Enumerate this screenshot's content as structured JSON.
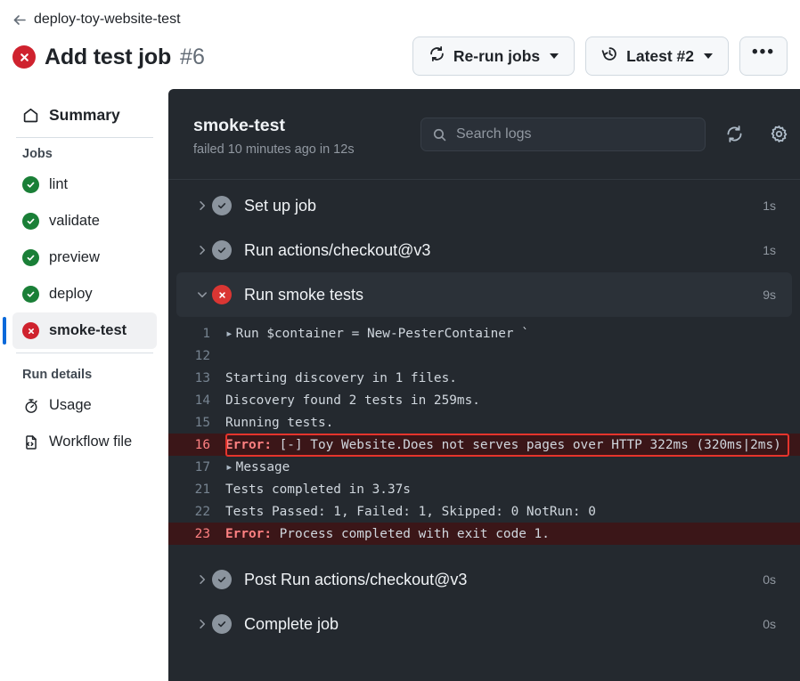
{
  "header": {
    "back_icon": "arrow-left-icon",
    "breadcrumb": "deploy-toy-website-test",
    "status_icon": "x-circle-icon",
    "title": "Add test job",
    "run_number": "#6",
    "actions": {
      "rerun_label": "Re-run jobs",
      "rerun_icon": "sync-icon",
      "latest_label": "Latest #2",
      "latest_icon": "history-icon",
      "overflow_label": "•••"
    }
  },
  "sidebar": {
    "summary": {
      "label": "Summary",
      "icon": "home-icon"
    },
    "jobs_heading": "Jobs",
    "jobs": [
      {
        "label": "lint",
        "status": "success",
        "icon": "check-circle-icon"
      },
      {
        "label": "validate",
        "status": "success",
        "icon": "check-circle-icon"
      },
      {
        "label": "preview",
        "status": "success",
        "icon": "check-circle-icon"
      },
      {
        "label": "deploy",
        "status": "success",
        "icon": "check-circle-icon"
      },
      {
        "label": "smoke-test",
        "status": "failure",
        "icon": "x-circle-icon",
        "selected": true
      }
    ],
    "run_details_heading": "Run details",
    "run_details": [
      {
        "label": "Usage",
        "icon": "stopwatch-icon"
      },
      {
        "label": "Workflow file",
        "icon": "file-code-icon"
      }
    ]
  },
  "log_panel": {
    "job_title": "smoke-test",
    "job_status": "failed 10 minutes ago in 12s",
    "search": {
      "placeholder": "Search logs",
      "icon": "search-icon"
    },
    "refresh_icon": "sync-icon",
    "settings_icon": "gear-icon",
    "steps": [
      {
        "name": "Set up job",
        "duration": "1s",
        "status": "success",
        "expanded": false
      },
      {
        "name": "Run actions/checkout@v3",
        "duration": "1s",
        "status": "success",
        "expanded": false
      },
      {
        "name": "Run smoke tests",
        "duration": "9s",
        "status": "failure",
        "expanded": true
      },
      {
        "name": "Post Run actions/checkout@v3",
        "duration": "0s",
        "status": "success",
        "expanded": false
      },
      {
        "name": "Complete job",
        "duration": "0s",
        "status": "success",
        "expanded": false
      }
    ],
    "log_lines": [
      {
        "num": "1",
        "text": "Run $container = New-PesterContainer `",
        "group": true
      },
      {
        "num": "12",
        "text": ""
      },
      {
        "num": "13",
        "text": "Starting discovery in 1 files."
      },
      {
        "num": "14",
        "text": "Discovery found 2 tests in 259ms."
      },
      {
        "num": "15",
        "text": "Running tests."
      },
      {
        "num": "16",
        "error_prefix": "Error:",
        "text": " [-] Toy Website.Does not serves pages over HTTP 322ms (320ms|2ms)",
        "error": true,
        "annotated": true
      },
      {
        "num": "17",
        "text": "Message",
        "group": true
      },
      {
        "num": "21",
        "text": "Tests completed in 3.37s"
      },
      {
        "num": "22",
        "text": "Tests Passed: 1, Failed: 1, Skipped: 0 NotRun: 0"
      },
      {
        "num": "23",
        "error_prefix": "Error:",
        "text": " Process completed with exit code 1.",
        "error": true
      }
    ]
  },
  "colors": {
    "accent_blue": "#0969da",
    "success_green": "#1a7f37",
    "failure_red": "#cf222e",
    "panel_bg": "#24292f",
    "error_row_bg": "#3b1618",
    "annotation_border": "#e5342c"
  }
}
